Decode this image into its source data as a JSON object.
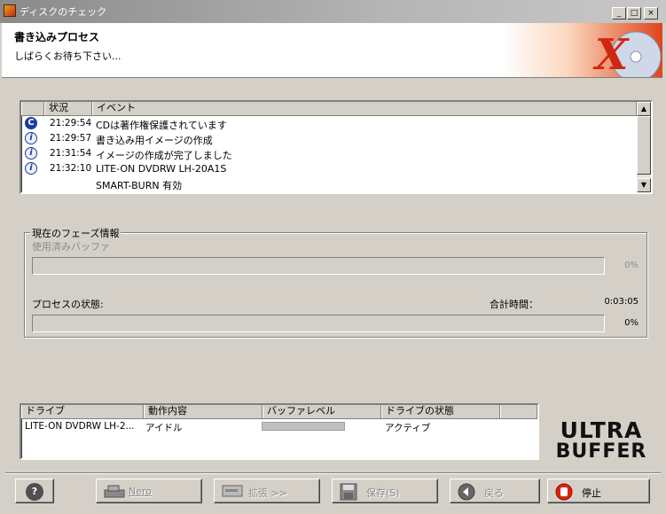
{
  "window": {
    "title": "ディスクのチェック",
    "buttons": {
      "minimize": "_",
      "maximize": "□",
      "close": "×"
    }
  },
  "header": {
    "title": "書き込みプロセス",
    "subtitle": "しばらくお待ち下さい..."
  },
  "event_list": {
    "columns": [
      "状況",
      "イベント"
    ],
    "rows": [
      {
        "icon": "copyright-icon",
        "time": "21:29:54",
        "text": "CDは著作権保護されています"
      },
      {
        "icon": "info-icon",
        "time": "21:29:57",
        "text": "書き込み用イメージの作成"
      },
      {
        "icon": "info-icon",
        "time": "21:31:54",
        "text": "イメージの作成が完了しました"
      },
      {
        "icon": "info-icon",
        "time": "21:32:10",
        "text": "LITE-ON DVDRW LH-20A1S"
      },
      {
        "icon": "",
        "time": "",
        "text": "SMART-BURN 有効"
      }
    ]
  },
  "phase": {
    "legend": "現在のフェーズ情報",
    "buffer_label": "使用済みバッファ",
    "buffer_percent": "0%",
    "buffer_fraction": 0,
    "process_label": "プロセスの状態:",
    "total_time_label": "合計時間：",
    "total_time_value": "0:03:05",
    "process_percent": "0%",
    "process_fraction": 0
  },
  "drive_list": {
    "columns": [
      "ドライブ",
      "動作内容",
      "バッファレベル",
      "ドライブの状態"
    ],
    "rows": [
      {
        "drive": "LITE-ON DVDRW LH-2...",
        "action": "アイドル",
        "status": "アクティブ"
      }
    ]
  },
  "logo": {
    "line1": "ULTRA",
    "line2": "BUFFER"
  },
  "buttons": {
    "help": "?",
    "nero": "Nero",
    "expand": "拡張 >>",
    "save": "保存(S)",
    "back": "戻る",
    "stop": "停止"
  },
  "colors": {
    "stop_red": "#e02010",
    "title_gray": "#a0a0a0",
    "info_blue": "#1a3a9a"
  }
}
